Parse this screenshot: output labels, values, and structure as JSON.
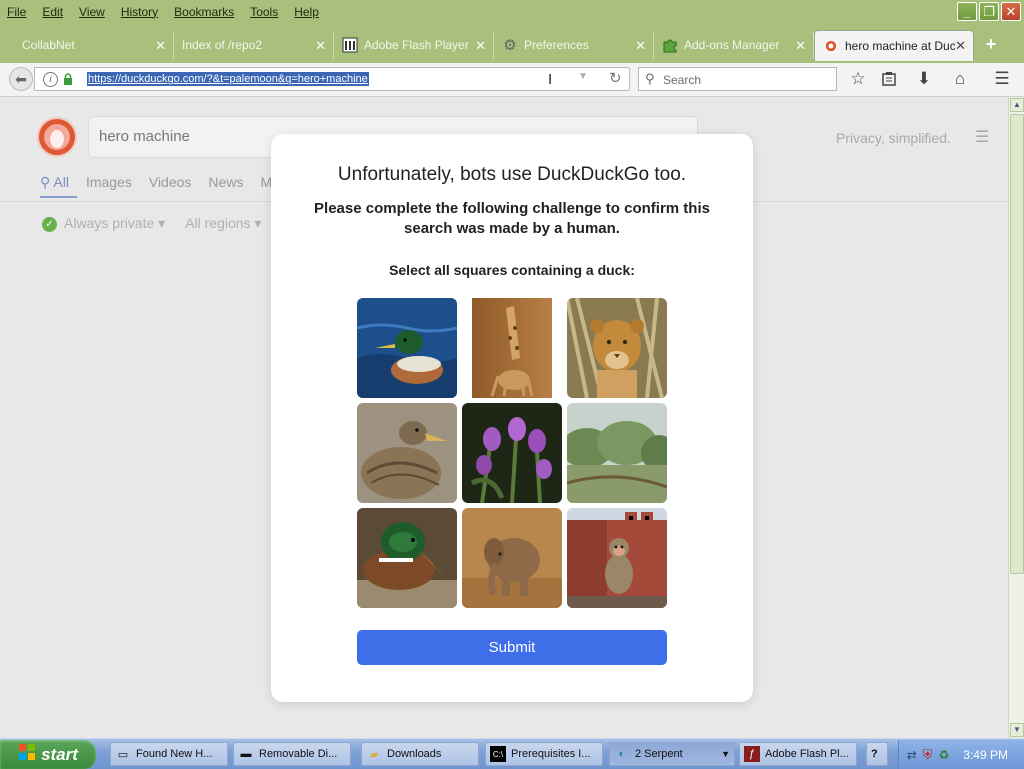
{
  "menubar": {
    "items": [
      "File",
      "Edit",
      "View",
      "History",
      "Bookmarks",
      "Tools",
      "Help"
    ]
  },
  "tabs": [
    {
      "label": "CollabNet",
      "icon": "none"
    },
    {
      "label": "Index of /repo2",
      "icon": "none"
    },
    {
      "label": "Adobe Flash Player",
      "icon": "building-icon"
    },
    {
      "label": "Preferences",
      "icon": "gear-icon"
    },
    {
      "label": "Add-ons Manager",
      "icon": "puzzle-icon"
    },
    {
      "label": "hero machine at Duc",
      "icon": "duckduckgo-icon",
      "active": true
    }
  ],
  "navbar": {
    "url": "https://duckduckgo.com/?&t=palemoon&q=hero+machine",
    "search_placeholder": "Search"
  },
  "ddg": {
    "query": "hero machine",
    "tagline": "Privacy, simplified.",
    "tabs": [
      "All",
      "Images",
      "Videos",
      "News",
      "M"
    ],
    "filters": [
      "Always private ▾",
      "All regions ▾"
    ]
  },
  "modal": {
    "title": "Unfortunately, bots use DuckDuckGo too.",
    "subtitle": "Please complete the following challenge to confirm this search was made by a human.",
    "instruction": "Select all squares containing a duck:",
    "submit_label": "Submit",
    "tiles": [
      {
        "subject": "duck swimming on blue water"
      },
      {
        "subject": "giraffe and calf"
      },
      {
        "subject": "lion cub in grass"
      },
      {
        "subject": "brown duck close-up"
      },
      {
        "subject": "purple flowers"
      },
      {
        "subject": "green trees landscape"
      },
      {
        "subject": "mallard duck head"
      },
      {
        "subject": "baby elephant"
      },
      {
        "subject": "monkey by red fort wall"
      }
    ]
  },
  "taskbar": {
    "start_label": "start",
    "tasks": [
      {
        "label": "Found New H...",
        "icon": "window-icon"
      },
      {
        "label": "Removable Di...",
        "icon": "drive-icon"
      },
      {
        "label": "Downloads",
        "icon": "folder-icon"
      },
      {
        "label": "Prerequisites I...",
        "icon": "console-icon"
      },
      {
        "label": "2  Serpent",
        "icon": "serpent-icon",
        "pressed": true
      },
      {
        "label": "Adobe Flash Pl...",
        "icon": "flash-icon"
      }
    ],
    "clock": "3:49 PM"
  },
  "colors": {
    "chrome_green": "#a9bf7c",
    "submit_blue": "#3f6fe8",
    "ddg_orange": "#de5833"
  }
}
